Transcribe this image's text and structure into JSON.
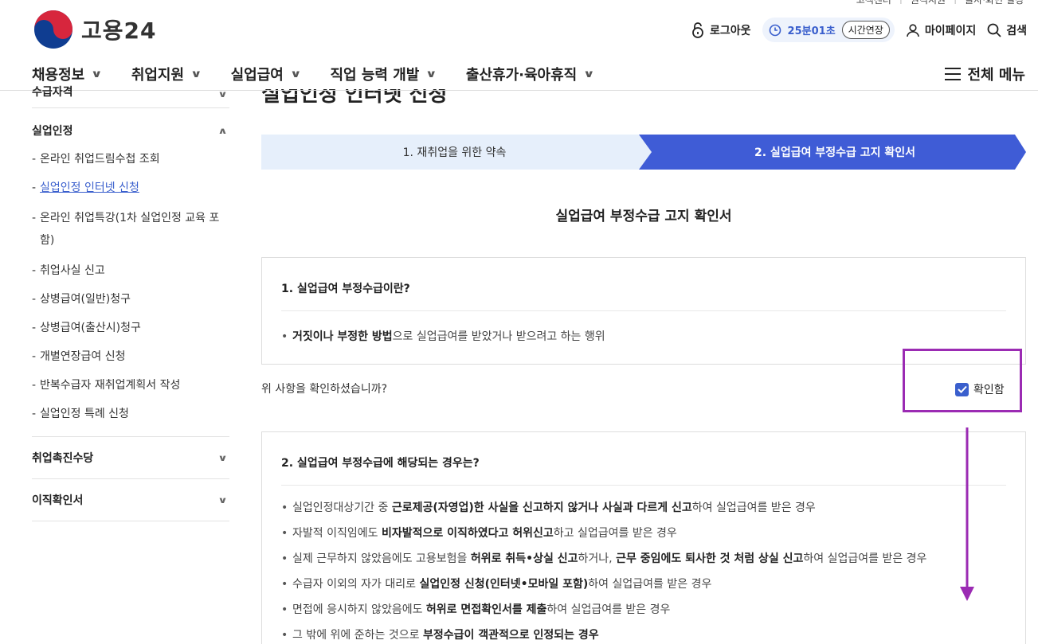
{
  "util": {
    "items": [
      "고객센터",
      "원격지원",
      "글자·화면 설정"
    ]
  },
  "header": {
    "logo_text": "고용24",
    "logout": "로그아웃",
    "timer": "25분01초",
    "extend": "시간연장",
    "mypage": "마이페이지",
    "search": "검색"
  },
  "nav": {
    "items": [
      "채용정보",
      "취업지원",
      "실업급여",
      "직업 능력 개발",
      "출산휴가·육아휴직"
    ],
    "all_menu": "전체 메뉴"
  },
  "sidebar": {
    "group_top": "수급자격",
    "group_active": "실업인정",
    "sub_items": [
      "온라인 취업드림수첩 조회",
      "실업인정 인터넷 신청",
      "온라인 취업특강(1차 실업인정 교육 포함)",
      "취업사실 신고",
      "상병급여(일반)청구",
      "상병급여(출산시)청구",
      "개별연장급여 신청",
      "반복수급자 재취업계획서 작성",
      "실업인정 특례 신청"
    ],
    "group_3": "취업촉진수당",
    "group_4": "이직확인서"
  },
  "page": {
    "title": "실업인정 인터넷 신청",
    "steps": [
      "1. 재취업을 위한 약속",
      "2. 실업급여 부정수급 고지 확인서"
    ],
    "section_title": "실업급여 부정수급 고지 확인서",
    "box1": {
      "heading": "1. 실업급여 부정수급이란?",
      "bullet_bold": "거짓이나 부정한 방법",
      "bullet_rest": "으로 실업급여를 받았거나 받으려고 하는 행위"
    },
    "confirm_question": "위 사항을 확인하셨습니까?",
    "confirm_label": "확인함",
    "box2": {
      "heading": "2. 실업급여 부정수급에 해당되는 경우는?",
      "items": [
        {
          "a": "실업인정대상기간 중 ",
          "b": "근로제공(자영업)한 사실을 신고하지 않거나 사실과 다르게 신고",
          "c": "하여 실업급여를 받은 경우"
        },
        {
          "a": "자발적 이직임에도 ",
          "b": "비자발적으로 이직하였다고 허위신고",
          "c": "하고 실업급여를 받은 경우"
        },
        {
          "a": "실제 근무하지 않았음에도 고용보험을 ",
          "b": "허위로 취득•상실 신고",
          "c": "하거나, "
        },
        {
          "a": "수급자 이외의 자가 대리로 ",
          "b": "실업인정 신청(인터넷•모바일 포함)",
          "c": "하여 실업급여를 받은 경우"
        },
        {
          "a": "면접에 응시하지 않았음에도 ",
          "b": "허위로 면접확인서를 제출",
          "c": "하여 실업급여를 받은 경우"
        },
        {
          "a": "그 밖에 위에 준하는 것으로 ",
          "b": "부정수급이 객관적으로 인정되는 경우",
          "c": ""
        }
      ],
      "item3_bold2": "근무 중임에도 퇴사한 것 처럼 상실 신고",
      "item3_tail": "하여 실업급여를 받은 경우"
    }
  },
  "colors": {
    "accent": "#3a5fcd",
    "step_inactive": "#e6effb",
    "annotation": "#9b2bb3"
  }
}
